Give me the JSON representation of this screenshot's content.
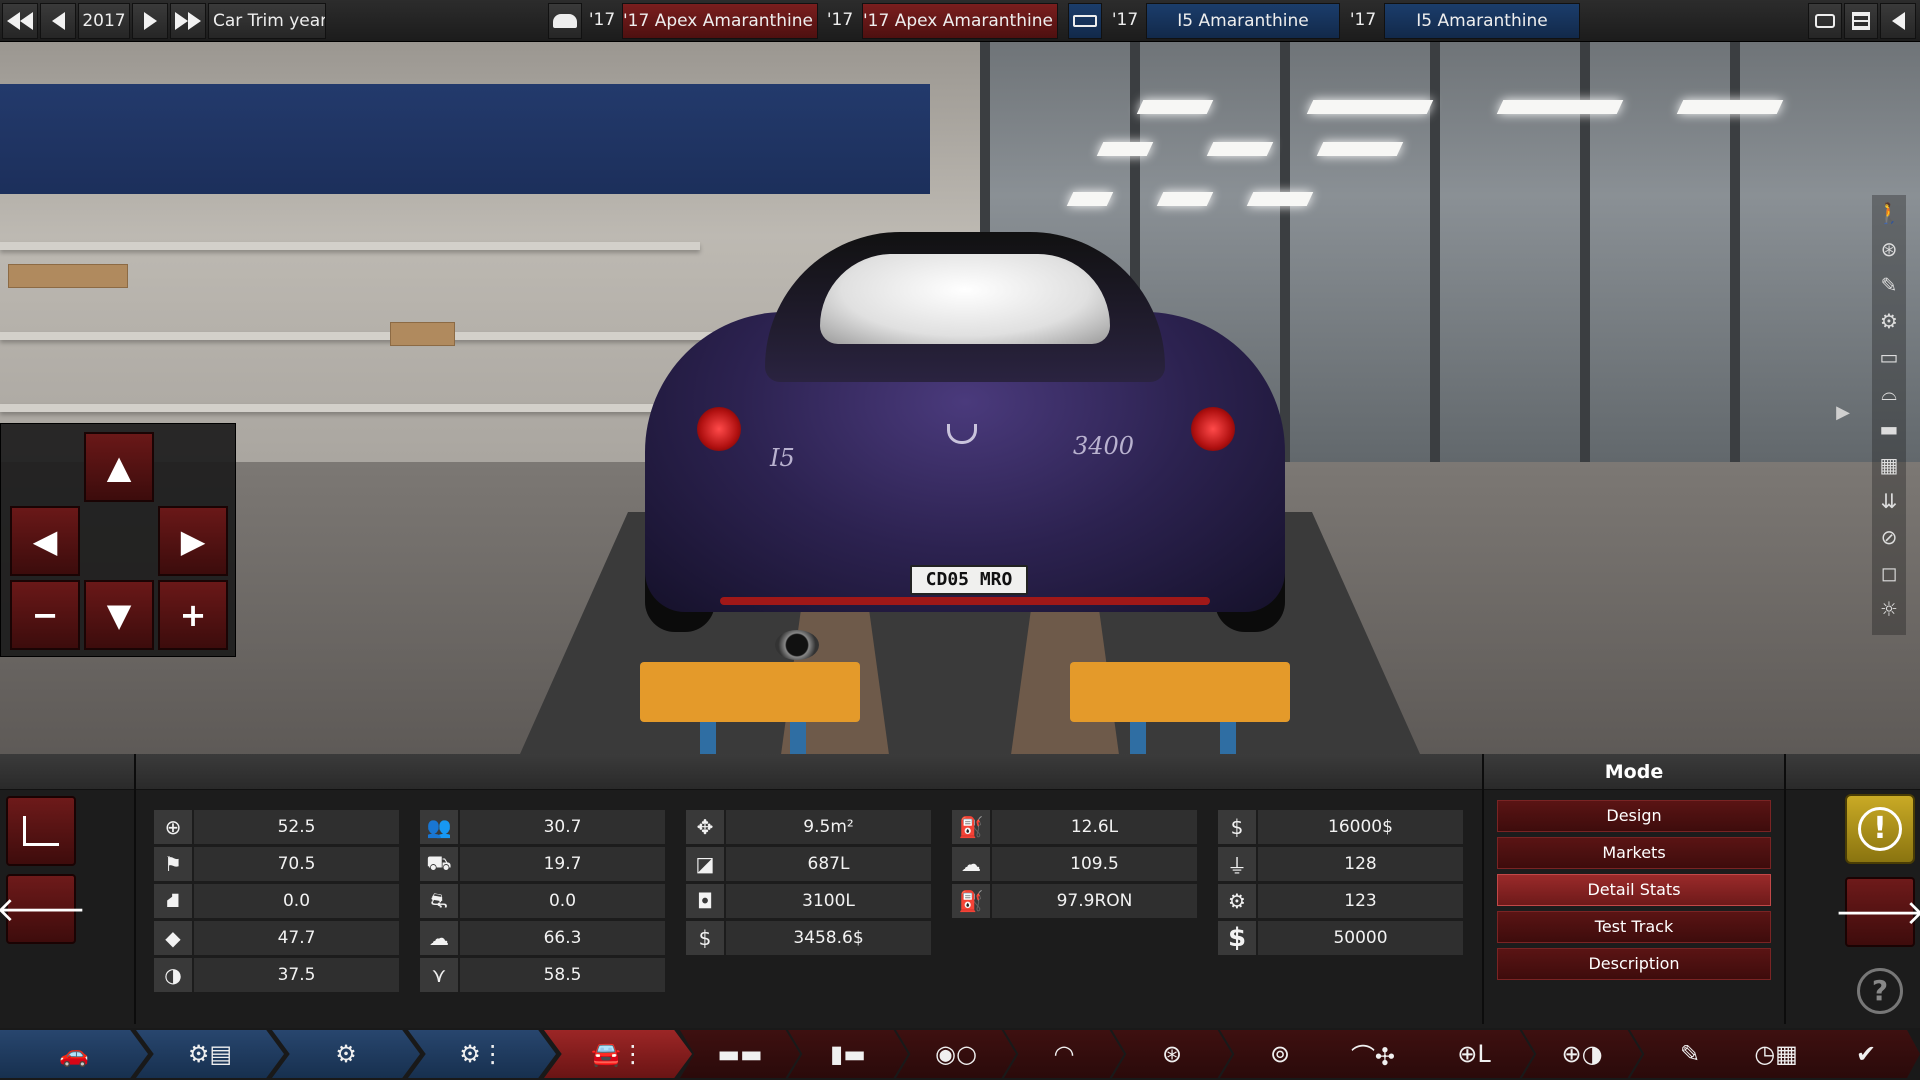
{
  "topbar": {
    "year": "2017",
    "trim_label": "Car Trim year",
    "compare": [
      {
        "year_tag": "'17",
        "name": "'17 Apex Amaranthine (",
        "style": "red"
      },
      {
        "year_tag": "'17",
        "name": "'17 Apex Amaranthine (",
        "style": "red"
      },
      {
        "year_tag": "'17",
        "name": "I5 Amaranthine",
        "style": "blue"
      },
      {
        "year_tag": "'17",
        "name": "I5 Amaranthine",
        "style": "blue"
      }
    ],
    "icons": [
      "rewind-icon",
      "prev-icon",
      "play-icon",
      "fast-forward-icon",
      "car-icon",
      "keyboard-icon",
      "camera-icon",
      "grid-icon",
      "back-icon"
    ]
  },
  "car": {
    "plate": "CD05 MRO",
    "badge_left": "I5",
    "badge_right": "3400"
  },
  "mode": {
    "title": "Mode",
    "buttons": [
      "Design",
      "Markets",
      "Detail Stats",
      "Test Track",
      "Description"
    ],
    "active": "Detail Stats"
  },
  "stats": {
    "col1": [
      "52.5",
      "70.5",
      "0.0",
      "47.7",
      "37.5"
    ],
    "col2": [
      "30.7",
      "19.7",
      "0.0",
      "66.3",
      "58.5"
    ],
    "col3": [
      "9.5m²",
      "687L",
      "3100L",
      "3458.6$"
    ],
    "col4": [
      "12.6L",
      "109.5",
      "97.9RON"
    ],
    "col5": [
      "16000$",
      "128",
      "123",
      "50000"
    ]
  },
  "colors": {
    "accent_red": "#6e1a1a",
    "active_red": "#9a2a2a",
    "nav_blue": "#28466e",
    "warning_yellow": "#c9aa25",
    "car_paint": "#2c2250"
  }
}
